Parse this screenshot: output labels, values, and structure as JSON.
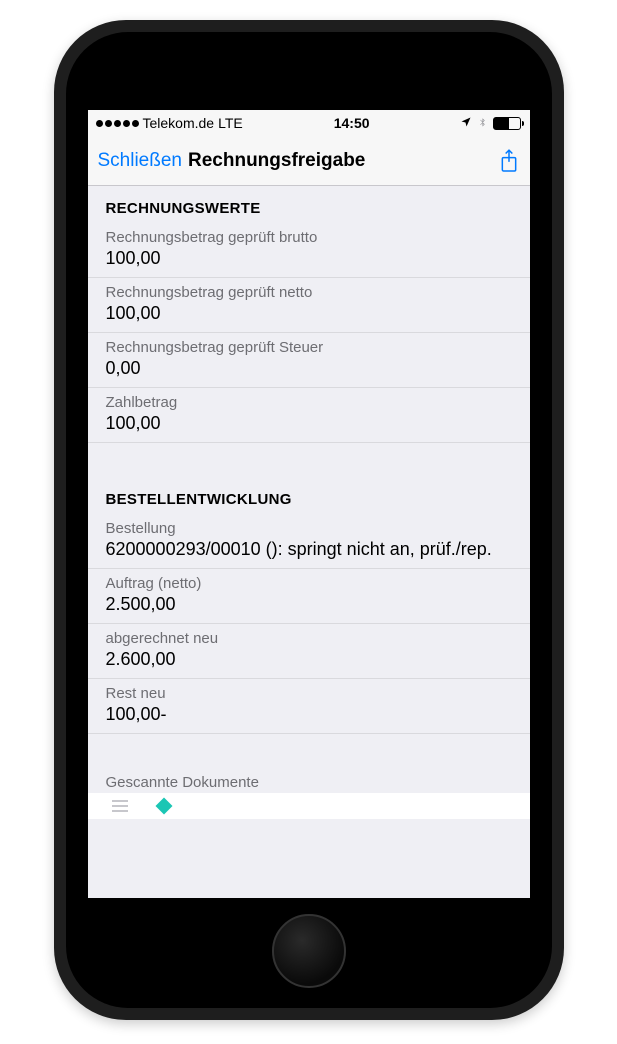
{
  "status": {
    "carrier": "Telekom.de",
    "network": "LTE",
    "time": "14:50"
  },
  "nav": {
    "close": "Schließen",
    "title": "Rechnungsfreigabe"
  },
  "sections": {
    "werte": {
      "header": "RECHNUNGSWERTE",
      "rows": [
        {
          "label": "Rechnungsbetrag geprüft brutto",
          "value": "100,00"
        },
        {
          "label": "Rechnungsbetrag geprüft netto",
          "value": "100,00"
        },
        {
          "label": "Rechnungsbetrag geprüft Steuer",
          "value": "0,00"
        },
        {
          "label": "Zahlbetrag",
          "value": "100,00"
        }
      ]
    },
    "bestell": {
      "header": "BESTELLENTWICKLUNG",
      "rows": [
        {
          "label": "Bestellung",
          "value": "6200000293/00010 (): springt nicht an, prüf./rep."
        },
        {
          "label": "Auftrag (netto)",
          "value": "2.500,00"
        },
        {
          "label": "abgerechnet neu",
          "value": "2.600,00"
        },
        {
          "label": "Rest neu",
          "value": "100,00-"
        }
      ]
    },
    "docs": {
      "label": "Gescannte Dokumente"
    }
  }
}
